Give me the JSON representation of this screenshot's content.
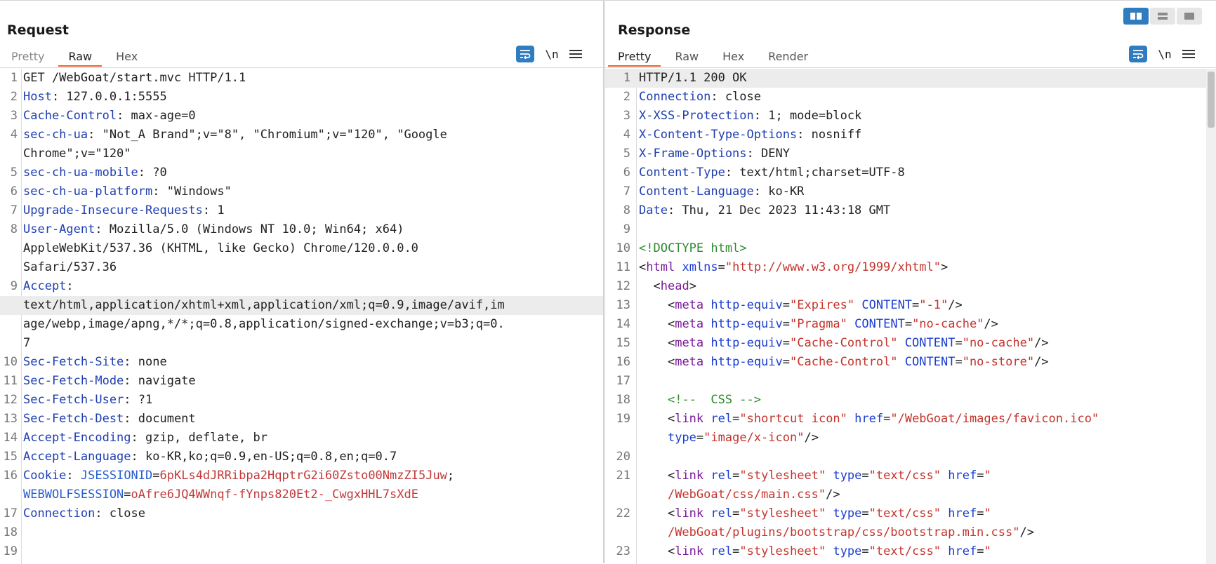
{
  "request": {
    "title": "Request",
    "tabs": [
      "Pretty",
      "Raw",
      "Hex"
    ],
    "active_tab": "Raw",
    "newline_toggle": "\\n",
    "lines": [
      {
        "n": "1",
        "parts": [
          [
            "v",
            "GET /WebGoat/start.mvc HTTP/1.1"
          ]
        ]
      },
      {
        "n": "2",
        "parts": [
          [
            "k",
            "Host"
          ],
          [
            "v",
            ": 127.0.0.1:5555"
          ]
        ]
      },
      {
        "n": "3",
        "parts": [
          [
            "k",
            "Cache-Control"
          ],
          [
            "v",
            ": max-age=0"
          ]
        ]
      },
      {
        "n": "4",
        "parts": [
          [
            "k",
            "sec-ch-ua"
          ],
          [
            "v",
            ": \"Not_A Brand\";v=\"8\", \"Chromium\";v=\"120\", \"Google"
          ]
        ]
      },
      {
        "n": "",
        "parts": [
          [
            "v",
            "Chrome\";v=\"120\""
          ]
        ]
      },
      {
        "n": "5",
        "parts": [
          [
            "k",
            "sec-ch-ua-mobile"
          ],
          [
            "v",
            ": ?0"
          ]
        ]
      },
      {
        "n": "6",
        "parts": [
          [
            "k",
            "sec-ch-ua-platform"
          ],
          [
            "v",
            ": \"Windows\""
          ]
        ]
      },
      {
        "n": "7",
        "parts": [
          [
            "k",
            "Upgrade-Insecure-Requests"
          ],
          [
            "v",
            ": 1"
          ]
        ]
      },
      {
        "n": "8",
        "parts": [
          [
            "k",
            "User-Agent"
          ],
          [
            "v",
            ": Mozilla/5.0 (Windows NT 10.0; Win64; x64)"
          ]
        ]
      },
      {
        "n": "",
        "parts": [
          [
            "v",
            "AppleWebKit/537.36 (KHTML, like Gecko) Chrome/120.0.0.0"
          ]
        ]
      },
      {
        "n": "",
        "parts": [
          [
            "v",
            "Safari/537.36"
          ]
        ]
      },
      {
        "n": "9",
        "parts": [
          [
            "k",
            "Accept"
          ],
          [
            "v",
            ":"
          ]
        ]
      },
      {
        "n": "",
        "hl": true,
        "parts": [
          [
            "v",
            "text/html,application/xhtml+xml,application/xml;q=0.9,image/avif,im"
          ]
        ]
      },
      {
        "n": "",
        "parts": [
          [
            "v",
            "age/webp,image/apng,*/*;q=0.8,application/signed-exchange;v=b3;q=0."
          ]
        ]
      },
      {
        "n": "",
        "parts": [
          [
            "v",
            "7"
          ]
        ]
      },
      {
        "n": "10",
        "parts": [
          [
            "k",
            "Sec-Fetch-Site"
          ],
          [
            "v",
            ": none"
          ]
        ]
      },
      {
        "n": "11",
        "parts": [
          [
            "k",
            "Sec-Fetch-Mode"
          ],
          [
            "v",
            ": navigate"
          ]
        ]
      },
      {
        "n": "12",
        "parts": [
          [
            "k",
            "Sec-Fetch-User"
          ],
          [
            "v",
            ": ?1"
          ]
        ]
      },
      {
        "n": "13",
        "parts": [
          [
            "k",
            "Sec-Fetch-Dest"
          ],
          [
            "v",
            ": document"
          ]
        ]
      },
      {
        "n": "14",
        "parts": [
          [
            "k",
            "Accept-Encoding"
          ],
          [
            "v",
            ": gzip, deflate, br"
          ]
        ]
      },
      {
        "n": "15",
        "parts": [
          [
            "k",
            "Accept-Language"
          ],
          [
            "v",
            ": ko-KR,ko;q=0.9,en-US;q=0.8,en;q=0.7"
          ]
        ]
      },
      {
        "n": "16",
        "parts": [
          [
            "k",
            "Cookie"
          ],
          [
            "v",
            ": "
          ],
          [
            "ck",
            "JSESSIONID"
          ],
          [
            "v",
            "="
          ],
          [
            "cv",
            "6pKLs4dJRRibpa2HqptrG2i60Zsto00NmzZI5Juw"
          ],
          [
            "v",
            ";"
          ]
        ]
      },
      {
        "n": "",
        "parts": [
          [
            "ck",
            "WEBWOLFSESSION"
          ],
          [
            "v",
            "="
          ],
          [
            "cv",
            "oAfre6JQ4WWnqf-fYnps820Et2-_CwgxHHL7sXdE"
          ]
        ]
      },
      {
        "n": "17",
        "parts": [
          [
            "k",
            "Connection"
          ],
          [
            "v",
            ": close"
          ]
        ]
      },
      {
        "n": "18",
        "parts": []
      },
      {
        "n": "19",
        "parts": []
      }
    ]
  },
  "response": {
    "title": "Response",
    "tabs": [
      "Pretty",
      "Raw",
      "Hex",
      "Render"
    ],
    "active_tab": "Pretty",
    "newline_toggle": "\\n",
    "lines": [
      {
        "n": "1",
        "hl": true,
        "parts": [
          [
            "v",
            "HTTP/1.1 200 OK"
          ]
        ]
      },
      {
        "n": "2",
        "parts": [
          [
            "k",
            "Connection"
          ],
          [
            "v",
            ": close"
          ]
        ]
      },
      {
        "n": "3",
        "parts": [
          [
            "k",
            "X-XSS-Protection"
          ],
          [
            "v",
            ": 1; mode=block"
          ]
        ]
      },
      {
        "n": "4",
        "parts": [
          [
            "k",
            "X-Content-Type-Options"
          ],
          [
            "v",
            ": nosniff"
          ]
        ]
      },
      {
        "n": "5",
        "parts": [
          [
            "k",
            "X-Frame-Options"
          ],
          [
            "v",
            ": DENY"
          ]
        ]
      },
      {
        "n": "6",
        "parts": [
          [
            "k",
            "Content-Type"
          ],
          [
            "v",
            ": text/html;charset=UTF-8"
          ]
        ]
      },
      {
        "n": "7",
        "parts": [
          [
            "k",
            "Content-Language"
          ],
          [
            "v",
            ": ko-KR"
          ]
        ]
      },
      {
        "n": "8",
        "parts": [
          [
            "k",
            "Date"
          ],
          [
            "v",
            ": Thu, 21 Dec 2023 11:43:18 GMT"
          ]
        ]
      },
      {
        "n": "9",
        "parts": []
      },
      {
        "n": "10",
        "parts": [
          [
            "comment",
            "<!DOCTYPE html>"
          ]
        ]
      },
      {
        "n": "11",
        "parts": [
          [
            "punc",
            "<"
          ],
          [
            "tag",
            "html"
          ],
          [
            "v",
            " "
          ],
          [
            "attr",
            "xmlns"
          ],
          [
            "punc",
            "="
          ],
          [
            "str",
            "\"http://www.w3.org/1999/xhtml\""
          ],
          [
            "punc",
            ">"
          ]
        ]
      },
      {
        "n": "12",
        "parts": [
          [
            "v",
            "  "
          ],
          [
            "punc",
            "<"
          ],
          [
            "tag",
            "head"
          ],
          [
            "punc",
            ">"
          ]
        ]
      },
      {
        "n": "13",
        "parts": [
          [
            "v",
            "    "
          ],
          [
            "punc",
            "<"
          ],
          [
            "tag",
            "meta"
          ],
          [
            "v",
            " "
          ],
          [
            "attr",
            "http-equiv"
          ],
          [
            "punc",
            "="
          ],
          [
            "str",
            "\"Expires\""
          ],
          [
            "v",
            " "
          ],
          [
            "attr",
            "CONTENT"
          ],
          [
            "punc",
            "="
          ],
          [
            "str",
            "\"-1\""
          ],
          [
            "punc",
            "/>"
          ]
        ]
      },
      {
        "n": "14",
        "parts": [
          [
            "v",
            "    "
          ],
          [
            "punc",
            "<"
          ],
          [
            "tag",
            "meta"
          ],
          [
            "v",
            " "
          ],
          [
            "attr",
            "http-equiv"
          ],
          [
            "punc",
            "="
          ],
          [
            "str",
            "\"Pragma\""
          ],
          [
            "v",
            " "
          ],
          [
            "attr",
            "CONTENT"
          ],
          [
            "punc",
            "="
          ],
          [
            "str",
            "\"no-cache\""
          ],
          [
            "punc",
            "/>"
          ]
        ]
      },
      {
        "n": "15",
        "parts": [
          [
            "v",
            "    "
          ],
          [
            "punc",
            "<"
          ],
          [
            "tag",
            "meta"
          ],
          [
            "v",
            " "
          ],
          [
            "attr",
            "http-equiv"
          ],
          [
            "punc",
            "="
          ],
          [
            "str",
            "\"Cache-Control\""
          ],
          [
            "v",
            " "
          ],
          [
            "attr",
            "CONTENT"
          ],
          [
            "punc",
            "="
          ],
          [
            "str",
            "\"no-cache\""
          ],
          [
            "punc",
            "/>"
          ]
        ]
      },
      {
        "n": "16",
        "parts": [
          [
            "v",
            "    "
          ],
          [
            "punc",
            "<"
          ],
          [
            "tag",
            "meta"
          ],
          [
            "v",
            " "
          ],
          [
            "attr",
            "http-equiv"
          ],
          [
            "punc",
            "="
          ],
          [
            "str",
            "\"Cache-Control\""
          ],
          [
            "v",
            " "
          ],
          [
            "attr",
            "CONTENT"
          ],
          [
            "punc",
            "="
          ],
          [
            "str",
            "\"no-store\""
          ],
          [
            "punc",
            "/>"
          ]
        ]
      },
      {
        "n": "17",
        "parts": []
      },
      {
        "n": "18",
        "parts": [
          [
            "v",
            "    "
          ],
          [
            "comment",
            "<!--  CSS -->"
          ]
        ]
      },
      {
        "n": "19",
        "parts": [
          [
            "v",
            "    "
          ],
          [
            "punc",
            "<"
          ],
          [
            "tag",
            "link"
          ],
          [
            "v",
            " "
          ],
          [
            "attr",
            "rel"
          ],
          [
            "punc",
            "="
          ],
          [
            "str",
            "\"shortcut icon\""
          ],
          [
            "v",
            " "
          ],
          [
            "attr",
            "href"
          ],
          [
            "punc",
            "="
          ],
          [
            "str",
            "\"/WebGoat/images/favicon.ico\""
          ]
        ]
      },
      {
        "n": "",
        "parts": [
          [
            "v",
            "    "
          ],
          [
            "attr",
            "type"
          ],
          [
            "punc",
            "="
          ],
          [
            "str",
            "\"image/x-icon\""
          ],
          [
            "punc",
            "/>"
          ]
        ]
      },
      {
        "n": "20",
        "parts": []
      },
      {
        "n": "21",
        "parts": [
          [
            "v",
            "    "
          ],
          [
            "punc",
            "<"
          ],
          [
            "tag",
            "link"
          ],
          [
            "v",
            " "
          ],
          [
            "attr",
            "rel"
          ],
          [
            "punc",
            "="
          ],
          [
            "str",
            "\"stylesheet\""
          ],
          [
            "v",
            " "
          ],
          [
            "attr",
            "type"
          ],
          [
            "punc",
            "="
          ],
          [
            "str",
            "\"text/css\""
          ],
          [
            "v",
            " "
          ],
          [
            "attr",
            "href"
          ],
          [
            "punc",
            "="
          ],
          [
            "str",
            "\""
          ]
        ]
      },
      {
        "n": "",
        "parts": [
          [
            "v",
            "    "
          ],
          [
            "str",
            "/WebGoat/css/main.css\""
          ],
          [
            "punc",
            "/>"
          ]
        ]
      },
      {
        "n": "22",
        "parts": [
          [
            "v",
            "    "
          ],
          [
            "punc",
            "<"
          ],
          [
            "tag",
            "link"
          ],
          [
            "v",
            " "
          ],
          [
            "attr",
            "rel"
          ],
          [
            "punc",
            "="
          ],
          [
            "str",
            "\"stylesheet\""
          ],
          [
            "v",
            " "
          ],
          [
            "attr",
            "type"
          ],
          [
            "punc",
            "="
          ],
          [
            "str",
            "\"text/css\""
          ],
          [
            "v",
            " "
          ],
          [
            "attr",
            "href"
          ],
          [
            "punc",
            "="
          ],
          [
            "str",
            "\""
          ]
        ]
      },
      {
        "n": "",
        "parts": [
          [
            "v",
            "    "
          ],
          [
            "str",
            "/WebGoat/plugins/bootstrap/css/bootstrap.min.css\""
          ],
          [
            "punc",
            "/>"
          ]
        ]
      },
      {
        "n": "23",
        "parts": [
          [
            "v",
            "    "
          ],
          [
            "punc",
            "<"
          ],
          [
            "tag",
            "link"
          ],
          [
            "v",
            " "
          ],
          [
            "attr",
            "rel"
          ],
          [
            "punc",
            "="
          ],
          [
            "str",
            "\"stylesheet\""
          ],
          [
            "v",
            " "
          ],
          [
            "attr",
            "type"
          ],
          [
            "punc",
            "="
          ],
          [
            "str",
            "\"text/css\""
          ],
          [
            "v",
            " "
          ],
          [
            "attr",
            "href"
          ],
          [
            "punc",
            "="
          ],
          [
            "str",
            "\""
          ]
        ]
      }
    ]
  },
  "layout_switch": [
    "split-horizontal",
    "split-vertical",
    "tabs"
  ]
}
